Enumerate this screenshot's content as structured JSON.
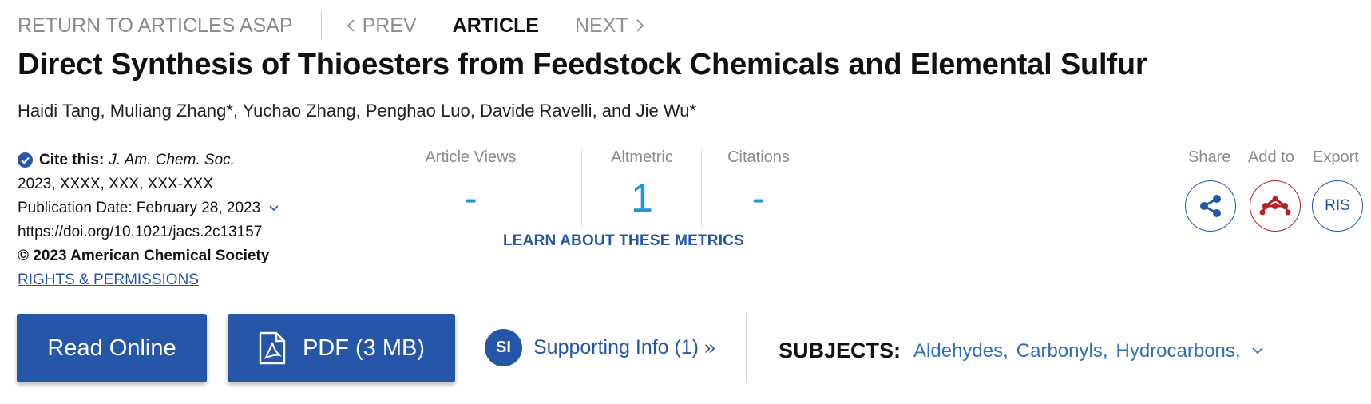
{
  "nav": {
    "return_label": "RETURN TO ARTICLES ASAP",
    "prev_label": "PREV",
    "article_label": "ARTICLE",
    "next_label": "NEXT"
  },
  "article": {
    "title": "Direct Synthesis of Thioesters from Feedstock Chemicals and Elemental Sulfur",
    "authors": "Haidi Tang, Muliang Zhang*, Yuchao Zhang, Penghao Luo, Davide Ravelli, and Jie Wu*"
  },
  "citation": {
    "cite_label": "Cite this:",
    "journal": "J. Am. Chem. Soc.",
    "reference": "2023, XXXX, XXX, XXX-XXX",
    "publication_date": "Publication Date: February 28, 2023",
    "doi": "https://doi.org/10.1021/jacs.2c13157",
    "copyright": "© 2023 American Chemical Society",
    "rights_link": "RIGHTS & PERMISSIONS"
  },
  "metrics": {
    "views_label": "Article Views",
    "views_value": "-",
    "altmetric_label": "Altmetric",
    "altmetric_value": "1",
    "citations_label": "Citations",
    "citations_value": "-",
    "learn_link": "LEARN ABOUT THESE METRICS"
  },
  "actions": {
    "share_label": "Share",
    "add_label": "Add to",
    "export_label": "Export",
    "export_button": "RIS",
    "share_icon": "share-icon",
    "add_icon": "mendeley-icon"
  },
  "buttons": {
    "read_online": "Read Online",
    "pdf": "PDF (3 MB)",
    "si_badge": "SI",
    "supporting_info": "Supporting Info (1) »"
  },
  "subjects": {
    "label": "SUBJECTS:",
    "items": [
      "Aldehydes",
      "Carbonyls",
      "Hydrocarbons"
    ]
  },
  "colors": {
    "primary_blue": "#2556a7",
    "metric_blue": "#1f97d4",
    "mendeley_red": "#b32025",
    "muted_gray": "#8c8c8c"
  }
}
